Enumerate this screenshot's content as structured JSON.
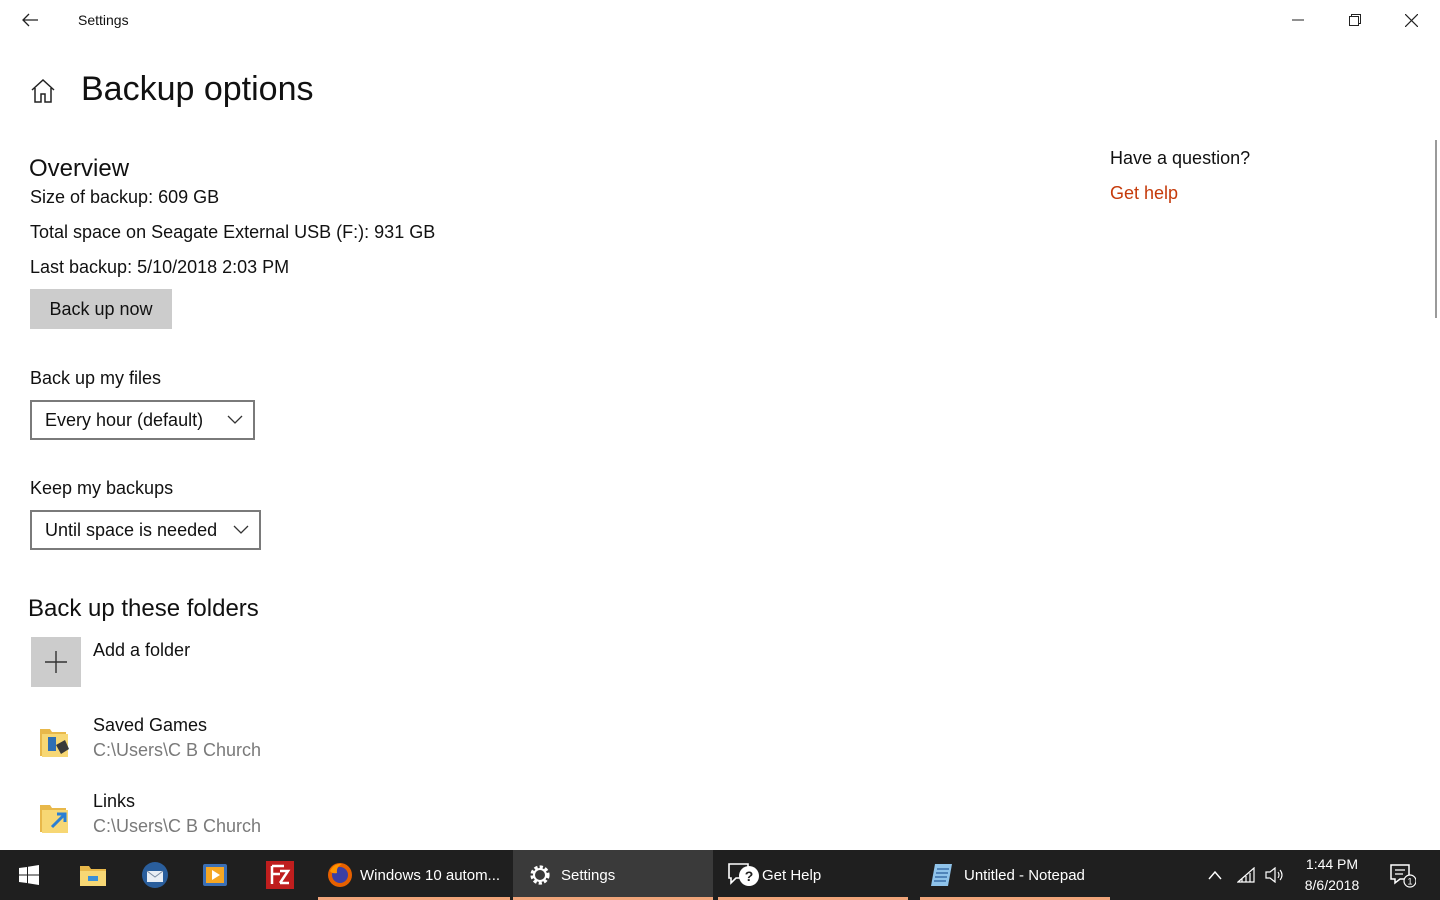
{
  "window": {
    "title": "Settings",
    "controls": [
      "minimize",
      "restore",
      "close"
    ]
  },
  "page": {
    "title": "Backup options"
  },
  "overview": {
    "heading": "Overview",
    "size_line": "Size of backup: 609 GB",
    "total_space_line": "Total space on Seagate External USB (F:): 931 GB",
    "last_backup_line": "Last backup: 5/10/2018 2:03 PM",
    "backup_now_label": "Back up now"
  },
  "frequency": {
    "label": "Back up my files",
    "selected": "Every hour (default)"
  },
  "retention": {
    "label": "Keep my backups",
    "selected": "Until space is needed"
  },
  "folders": {
    "heading": "Back up these folders",
    "add_label": "Add a folder",
    "items": [
      {
        "name": "Saved Games",
        "path": "C:\\Users\\C B Church",
        "icon": "saved-games-folder-icon"
      },
      {
        "name": "Links",
        "path": "C:\\Users\\C B Church",
        "icon": "links-folder-icon"
      }
    ]
  },
  "sidebar": {
    "question": "Have a question?",
    "help_link": "Get help"
  },
  "taskbar": {
    "apps": [
      {
        "label": "Windows 10 autom...",
        "icon": "firefox-icon",
        "active": false
      },
      {
        "label": "Settings",
        "icon": "gear-icon",
        "active": true
      },
      {
        "label": "Get Help",
        "icon": "get-help-icon",
        "active": false
      },
      {
        "label": "Untitled - Notepad",
        "icon": "notepad-icon",
        "active": false
      }
    ],
    "pinned": [
      "file-explorer-icon",
      "thunderbird-icon",
      "media-player-icon",
      "filezilla-icon"
    ],
    "clock": {
      "time": "1:44 PM",
      "date": "8/6/2018"
    },
    "notification_count": "1"
  },
  "colors": {
    "accent_link": "#c53a0a",
    "taskbar_bg": "#1f1f1f",
    "taskbar_underline": "#f0a47a",
    "button_gray": "#cccccc"
  }
}
